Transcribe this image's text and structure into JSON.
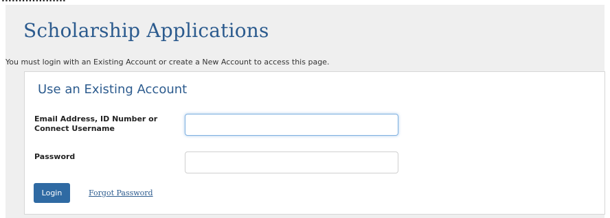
{
  "top_fragment": "...................",
  "page": {
    "title": "Scholarship Applications",
    "notice": "You must login with an Existing Account or create a New Account to access this page."
  },
  "login_card": {
    "title": "Use an Existing Account",
    "email_label": "Email Address, ID Number or Connect Username",
    "email_value": "",
    "password_label": "Password",
    "password_value": "",
    "login_button": "Login",
    "forgot_link": "Forgot Password"
  },
  "colors": {
    "accent": "#2c5b8e",
    "button_bg": "#2f6aa3",
    "panel_bg": "#efefef",
    "focus_border": "#7fb0e0"
  }
}
